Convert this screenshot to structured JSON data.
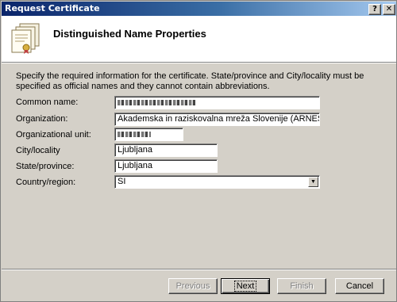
{
  "window": {
    "title": "Request Certificate",
    "help_label": "?",
    "close_label": "✕"
  },
  "header": {
    "title": "Distinguished Name Properties",
    "icon": "certificate-icon"
  },
  "description": "Specify the required information for the certificate. State/province and City/locality must be specified as official names and they cannot contain abbreviations.",
  "form": {
    "common_name": {
      "label": "Common name:",
      "value": ""
    },
    "organization": {
      "label": "Organization:",
      "value": "Akademska in raziskovalna mreža Slovenije (ARNES)"
    },
    "organizational_unit": {
      "label": "Organizational unit:",
      "value": ""
    },
    "city": {
      "label": "City/locality",
      "value": "Ljubljana"
    },
    "state": {
      "label": "State/province:",
      "value": "Ljubljana"
    },
    "country": {
      "label": "Country/region:",
      "value": "SI"
    }
  },
  "buttons": {
    "previous": "Previous",
    "next": "Next",
    "finish": "Finish",
    "cancel": "Cancel"
  }
}
